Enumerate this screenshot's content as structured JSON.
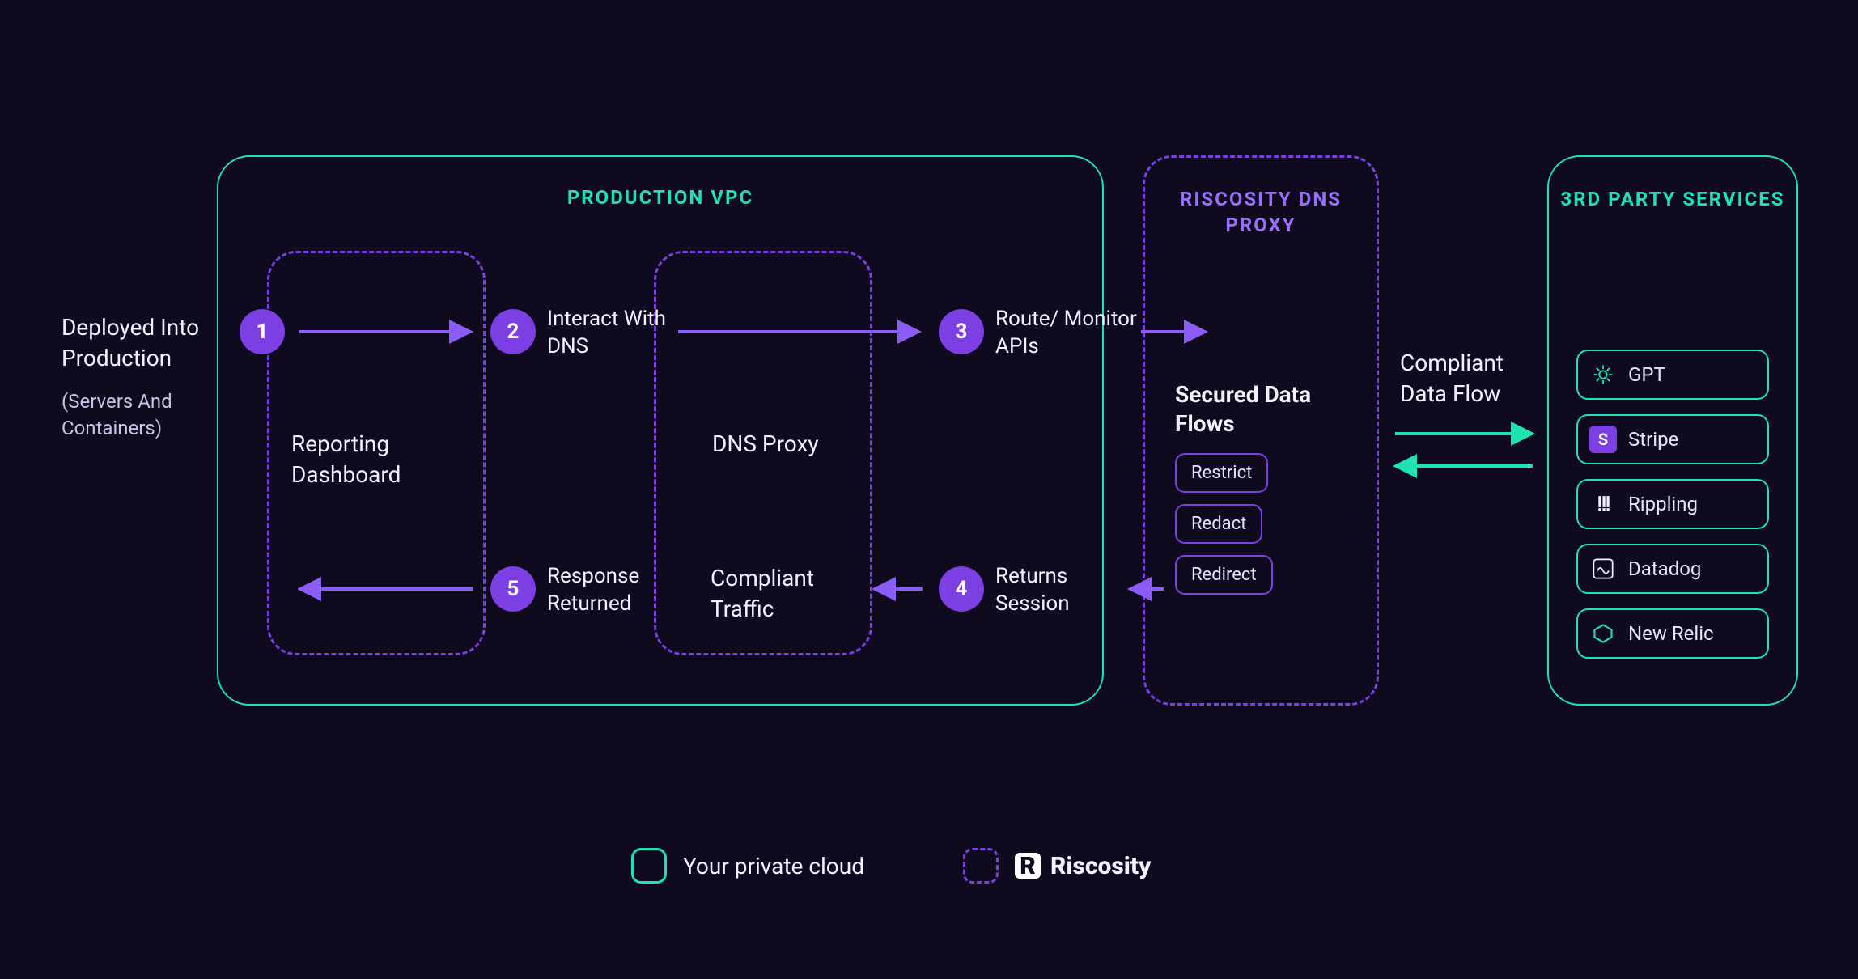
{
  "colors": {
    "bg": "#100A1F",
    "teal": "#1EE2B0",
    "purple": "#7B3FE4",
    "purpleLight": "#9B6DFF",
    "text": "#F3F0FF"
  },
  "deployed": {
    "title": "Deployed Into Production",
    "sub": "(Servers And Containers)"
  },
  "vpc": {
    "title": "PRODUCTION VPC",
    "reporting": "Reporting Dashboard",
    "dnsProxy": "DNS Proxy",
    "compliantTraffic": "Compliant Traffic"
  },
  "riscosity": {
    "title": "RISCOSITY DNS PROXY",
    "securedTitle": "Secured Data Flows",
    "actions": [
      "Restrict",
      "Redact",
      "Redirect"
    ]
  },
  "thirdParty": {
    "title": "3RD PARTY SERVICES",
    "compliantFlow": "Compliant Data Flow",
    "services": [
      {
        "name": "GPT",
        "icon": "gpt"
      },
      {
        "name": "Stripe",
        "icon": "stripe"
      },
      {
        "name": "Rippling",
        "icon": "rippling"
      },
      {
        "name": "Datadog",
        "icon": "datadog"
      },
      {
        "name": "New Relic",
        "icon": "newrelic"
      }
    ]
  },
  "steps": {
    "s1": {
      "n": "1",
      "label": ""
    },
    "s2": {
      "n": "2",
      "label": "Interact With DNS"
    },
    "s3": {
      "n": "3",
      "label": "Route/ Monitor APIs"
    },
    "s4": {
      "n": "4",
      "label": "Returns Session"
    },
    "s5": {
      "n": "5",
      "label": "Response Returned"
    }
  },
  "legend": {
    "privateCloud": "Your private cloud",
    "brand": "Riscosity"
  }
}
